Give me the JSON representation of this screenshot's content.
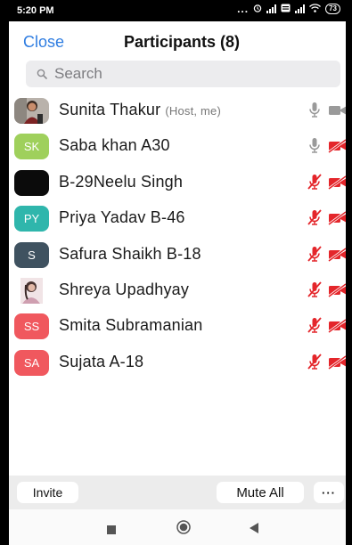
{
  "status_bar": {
    "time": "5:20 PM",
    "dots": "...",
    "battery": "73"
  },
  "header": {
    "close_label": "Close",
    "title": "Participants (8)"
  },
  "search": {
    "placeholder": "Search"
  },
  "participants": [
    {
      "name": "Sunita Thakur",
      "role": "(Host, me)",
      "initials": "",
      "avatar_color": "#6f6a66",
      "avatar_type": "photo",
      "mic": "on",
      "camera": "on"
    },
    {
      "name": "Saba khan A30",
      "role": "",
      "initials": "SK",
      "avatar_color": "#9fd05c",
      "avatar_type": "initials",
      "mic": "on",
      "camera": "off"
    },
    {
      "name": "B-29Neelu Singh",
      "role": "",
      "initials": "",
      "avatar_color": "#0b0b0b",
      "avatar_type": "dark",
      "mic": "off",
      "camera": "off"
    },
    {
      "name": "Priya Yadav B-46",
      "role": "",
      "initials": "PY",
      "avatar_color": "#2fb6ac",
      "avatar_type": "initials",
      "mic": "off",
      "camera": "off"
    },
    {
      "name": "Safura Shaikh B-18",
      "role": "",
      "initials": "S",
      "avatar_color": "#3f5260",
      "avatar_type": "initials",
      "mic": "off",
      "camera": "off"
    },
    {
      "name": "Shreya Upadhyay",
      "role": "",
      "initials": "",
      "avatar_color": "#e9d9db",
      "avatar_type": "photo2",
      "mic": "off",
      "camera": "off"
    },
    {
      "name": "Smita Subramanian",
      "role": "",
      "initials": "SS",
      "avatar_color": "#f0585e",
      "avatar_type": "initials",
      "mic": "off",
      "camera": "off"
    },
    {
      "name": "Sujata A-18",
      "role": "",
      "initials": "SA",
      "avatar_color": "#f0585e",
      "avatar_type": "initials",
      "mic": "off",
      "camera": "off"
    }
  ],
  "bottom_bar": {
    "invite_label": "Invite",
    "mute_all_label": "Mute All",
    "more_label": "···"
  },
  "colors": {
    "accent": "#2f7de1",
    "muted_red": "#e4262b",
    "icon_gray": "#9a9a9a"
  },
  "icons": {
    "mic_on": "microphone-icon",
    "mic_off": "microphone-muted-icon",
    "cam_on": "video-camera-icon",
    "cam_off": "video-camera-off-icon"
  }
}
